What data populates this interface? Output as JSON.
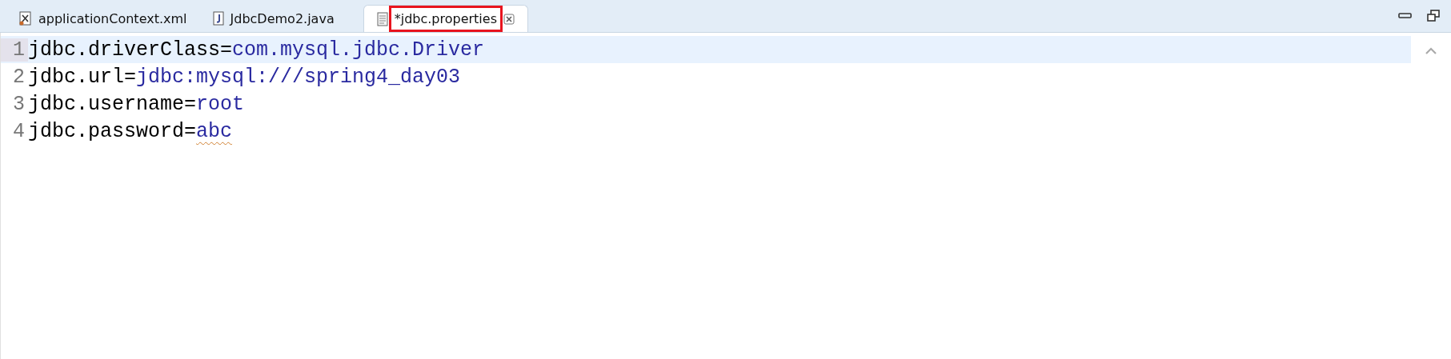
{
  "tabs": [
    {
      "label": "applicationContext.xml",
      "kind": "xml",
      "selected": false,
      "highlighted": false
    },
    {
      "label": "JdbcDemo2.java",
      "kind": "java",
      "selected": false,
      "highlighted": false
    },
    {
      "label": "*jdbc.properties",
      "kind": "properties",
      "selected": true,
      "highlighted": true
    }
  ],
  "lines": [
    {
      "number": "1",
      "key": "jdbc.driverClass=",
      "value": "com.mysql.jdbc.Driver",
      "current": true,
      "warning": false
    },
    {
      "number": "2",
      "key": "jdbc.url=",
      "value": "jdbc:mysql:///spring4_day03",
      "current": false,
      "warning": false
    },
    {
      "number": "3",
      "key": "jdbc.username=",
      "value": "root",
      "current": false,
      "warning": false
    },
    {
      "number": "4",
      "key": "jdbc.password=",
      "value": "abc",
      "current": false,
      "warning": true
    }
  ]
}
